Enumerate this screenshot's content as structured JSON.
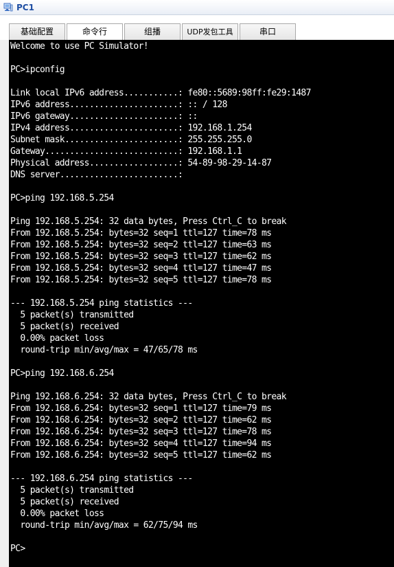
{
  "window": {
    "title": "PC1"
  },
  "tabs": [
    {
      "label": "基础配置",
      "active": false
    },
    {
      "label": "命令行",
      "active": true
    },
    {
      "label": "组播",
      "active": false
    },
    {
      "label": "UDP发包工具",
      "active": false
    },
    {
      "label": "串口",
      "active": false
    }
  ],
  "terminal": {
    "lines": [
      "Welcome to use PC Simulator!",
      "",
      "PC>ipconfig",
      "",
      "Link local IPv6 address...........: fe80::5689:98ff:fe29:1487",
      "IPv6 address......................: :: / 128",
      "IPv6 gateway......................: ::",
      "IPv4 address......................: 192.168.1.254",
      "Subnet mask.......................: 255.255.255.0",
      "Gateway...........................: 192.168.1.1",
      "Physical address..................: 54-89-98-29-14-87",
      "DNS server........................:",
      "",
      "PC>ping 192.168.5.254",
      "",
      "Ping 192.168.5.254: 32 data bytes, Press Ctrl_C to break",
      "From 192.168.5.254: bytes=32 seq=1 ttl=127 time=78 ms",
      "From 192.168.5.254: bytes=32 seq=2 ttl=127 time=63 ms",
      "From 192.168.5.254: bytes=32 seq=3 ttl=127 time=62 ms",
      "From 192.168.5.254: bytes=32 seq=4 ttl=127 time=47 ms",
      "From 192.168.5.254: bytes=32 seq=5 ttl=127 time=78 ms",
      "",
      "--- 192.168.5.254 ping statistics ---",
      "  5 packet(s) transmitted",
      "  5 packet(s) received",
      "  0.00% packet loss",
      "  round-trip min/avg/max = 47/65/78 ms",
      "",
      "PC>ping 192.168.6.254",
      "",
      "Ping 192.168.6.254: 32 data bytes, Press Ctrl_C to break",
      "From 192.168.6.254: bytes=32 seq=1 ttl=127 time=79 ms",
      "From 192.168.6.254: bytes=32 seq=2 ttl=127 time=62 ms",
      "From 192.168.6.254: bytes=32 seq=3 ttl=127 time=78 ms",
      "From 192.168.6.254: bytes=32 seq=4 ttl=127 time=94 ms",
      "From 192.168.6.254: bytes=32 seq=5 ttl=127 time=62 ms",
      "",
      "--- 192.168.6.254 ping statistics ---",
      "  5 packet(s) transmitted",
      "  5 packet(s) received",
      "  0.00% packet loss",
      "  round-trip min/avg/max = 62/75/94 ms",
      "",
      "PC>"
    ]
  },
  "colors": {
    "terminal_bg": "#000000",
    "terminal_fg": "#ffffff",
    "title_text": "#1f4fa3"
  }
}
